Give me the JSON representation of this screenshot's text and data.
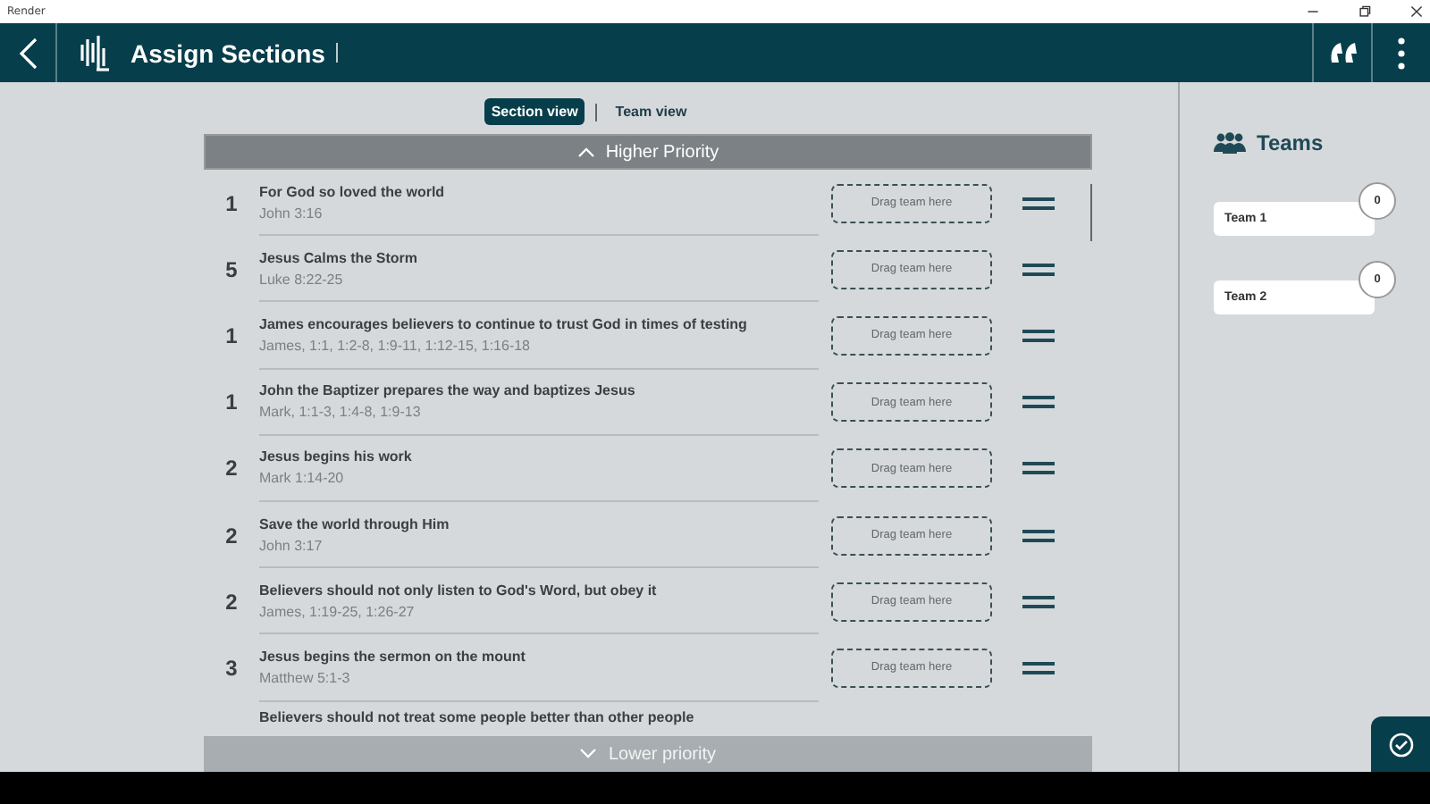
{
  "window": {
    "title": "Render"
  },
  "header": {
    "title": "Assign Sections"
  },
  "view_toggle": [
    {
      "label": "Section view",
      "selected": true
    },
    {
      "label": "Team view",
      "selected": false
    }
  ],
  "higher_priority": {
    "label": "Higher Priority"
  },
  "sections": [
    {
      "kind": "full",
      "number": "1",
      "title": "For God so loved the world",
      "reference": "John 3:16",
      "drop_hint": "Drag team here"
    },
    {
      "kind": "full",
      "number": "5",
      "title": "Jesus Calms the Storm",
      "reference": "Luke 8:22-25",
      "drop_hint": "Drag team here"
    },
    {
      "kind": "full",
      "number": "1",
      "title": "James encourages believers to continue to trust God in times of testing",
      "reference": "James, 1:1, 1:2-8, 1:9-11, 1:12-15, 1:16-18",
      "drop_hint": "Drag team here"
    },
    {
      "kind": "full",
      "number": "1",
      "title": "John the Baptizer prepares the way and baptizes Jesus",
      "reference": "Mark, 1:1-3, 1:4-8, 1:9-13",
      "drop_hint": "Drag team here"
    },
    {
      "kind": "full",
      "number": "2",
      "title": "Jesus begins his work",
      "reference": "Mark 1:14-20",
      "drop_hint": "Drag team here"
    },
    {
      "kind": "full",
      "number": "2",
      "title": "Save the world through Him",
      "reference": "John 3:17",
      "drop_hint": "Drag team here"
    },
    {
      "kind": "full",
      "number": "2",
      "title": "Believers should not only listen to God's Word, but obey it",
      "reference": "James, 1:19-25, 1:26-27",
      "drop_hint": "Drag team here"
    },
    {
      "kind": "full",
      "number": "3",
      "title": "Jesus begins the sermon on the mount",
      "reference": "Matthew 5:1-3",
      "drop_hint": "Drag team here"
    },
    {
      "kind": "partial",
      "title": "Believers should not treat some people better than other people"
    }
  ],
  "lower_priority": {
    "label": "Lower priority"
  },
  "teams_panel": {
    "title": "Teams",
    "teams": [
      {
        "name": "Team 1",
        "count": "0"
      },
      {
        "name": "Team 2",
        "count": "0"
      }
    ]
  }
}
